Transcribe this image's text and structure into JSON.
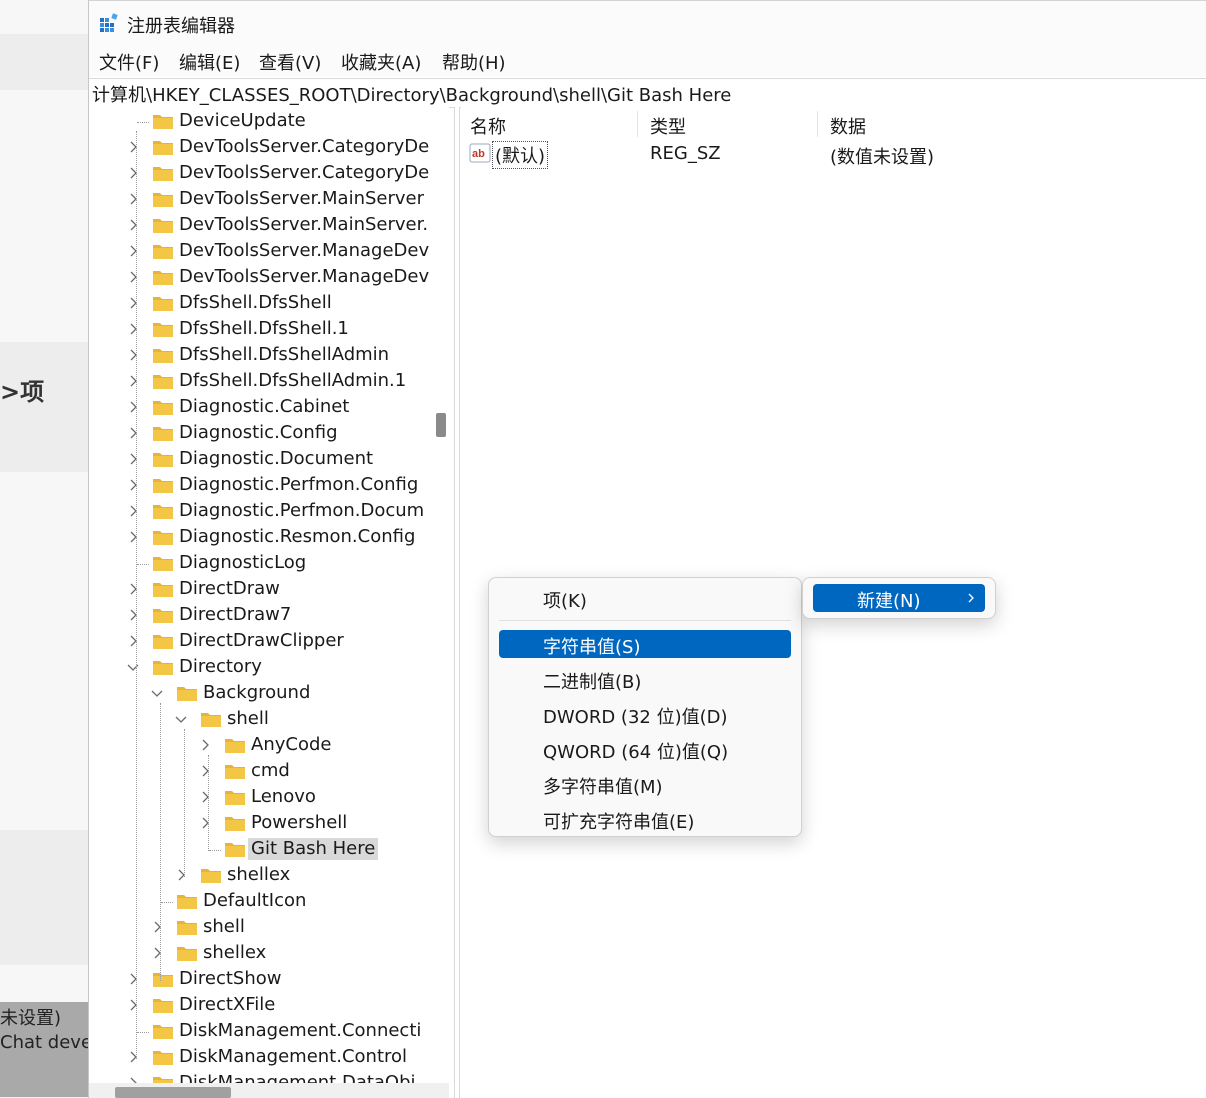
{
  "background_app": {
    "item_label": ">项",
    "lower_text_1": "未设置)",
    "lower_text_2": "Chat deve"
  },
  "window": {
    "title": "注册表编辑器",
    "icon": "registry-editor-icon"
  },
  "menu": [
    "文件(F)",
    "编辑(E)",
    "查看(V)",
    "收藏夹(A)",
    "帮助(H)"
  ],
  "address": "计算机\\HKEY_CLASSES_ROOT\\Directory\\Background\\shell\\Git Bash Here",
  "tree": [
    {
      "label": "DeviceUpdate",
      "depth": 0,
      "expander": "none"
    },
    {
      "label": "DevToolsServer.CategoryDe",
      "depth": 0,
      "expander": "collapsed"
    },
    {
      "label": "DevToolsServer.CategoryDe",
      "depth": 0,
      "expander": "collapsed"
    },
    {
      "label": "DevToolsServer.MainServer",
      "depth": 0,
      "expander": "collapsed"
    },
    {
      "label": "DevToolsServer.MainServer.",
      "depth": 0,
      "expander": "collapsed"
    },
    {
      "label": "DevToolsServer.ManageDev",
      "depth": 0,
      "expander": "collapsed"
    },
    {
      "label": "DevToolsServer.ManageDev",
      "depth": 0,
      "expander": "collapsed"
    },
    {
      "label": "DfsShell.DfsShell",
      "depth": 0,
      "expander": "collapsed"
    },
    {
      "label": "DfsShell.DfsShell.1",
      "depth": 0,
      "expander": "collapsed"
    },
    {
      "label": "DfsShell.DfsShellAdmin",
      "depth": 0,
      "expander": "collapsed"
    },
    {
      "label": "DfsShell.DfsShellAdmin.1",
      "depth": 0,
      "expander": "collapsed"
    },
    {
      "label": "Diagnostic.Cabinet",
      "depth": 0,
      "expander": "collapsed"
    },
    {
      "label": "Diagnostic.Config",
      "depth": 0,
      "expander": "collapsed"
    },
    {
      "label": "Diagnostic.Document",
      "depth": 0,
      "expander": "collapsed"
    },
    {
      "label": "Diagnostic.Perfmon.Config",
      "depth": 0,
      "expander": "collapsed"
    },
    {
      "label": "Diagnostic.Perfmon.Docum",
      "depth": 0,
      "expander": "collapsed"
    },
    {
      "label": "Diagnostic.Resmon.Config",
      "depth": 0,
      "expander": "collapsed"
    },
    {
      "label": "DiagnosticLog",
      "depth": 0,
      "expander": "none"
    },
    {
      "label": "DirectDraw",
      "depth": 0,
      "expander": "collapsed"
    },
    {
      "label": "DirectDraw7",
      "depth": 0,
      "expander": "collapsed"
    },
    {
      "label": "DirectDrawClipper",
      "depth": 0,
      "expander": "collapsed"
    },
    {
      "label": "Directory",
      "depth": 0,
      "expander": "expanded"
    },
    {
      "label": "Background",
      "depth": 1,
      "expander": "expanded"
    },
    {
      "label": "shell",
      "depth": 2,
      "expander": "expanded"
    },
    {
      "label": "AnyCode",
      "depth": 3,
      "expander": "collapsed"
    },
    {
      "label": "cmd",
      "depth": 3,
      "expander": "collapsed"
    },
    {
      "label": "Lenovo",
      "depth": 3,
      "expander": "collapsed"
    },
    {
      "label": "Powershell",
      "depth": 3,
      "expander": "collapsed"
    },
    {
      "label": "Git Bash Here",
      "depth": 3,
      "expander": "none",
      "selected": true
    },
    {
      "label": "shellex",
      "depth": 2,
      "expander": "collapsed"
    },
    {
      "label": "DefaultIcon",
      "depth": 1,
      "expander": "none"
    },
    {
      "label": "shell",
      "depth": 1,
      "expander": "collapsed"
    },
    {
      "label": "shellex",
      "depth": 1,
      "expander": "collapsed"
    },
    {
      "label": "DirectShow",
      "depth": 0,
      "expander": "collapsed"
    },
    {
      "label": "DirectXFile",
      "depth": 0,
      "expander": "collapsed"
    },
    {
      "label": "DiskManagement.Connecti",
      "depth": 0,
      "expander": "none"
    },
    {
      "label": "DiskManagement.Control",
      "depth": 0,
      "expander": "collapsed"
    },
    {
      "label": "DiskManagement.DataObj",
      "depth": 0,
      "expander": "collapsed"
    }
  ],
  "list": {
    "headers": {
      "name": "名称",
      "type": "类型",
      "data": "数据"
    },
    "rows": [
      {
        "name": "(默认)",
        "type": "REG_SZ",
        "data": "(数值未设置)",
        "icon": "string-value-icon"
      }
    ]
  },
  "context_menu": {
    "new_label": "新建(N)",
    "submenu": {
      "key_item": "项(K)",
      "items": [
        "字符串值(S)",
        "二进制值(B)",
        "DWORD (32 位)值(D)",
        "QWORD (64 位)值(Q)",
        "多字符串值(M)",
        "可扩充字符串值(E)"
      ],
      "highlighted": "字符串值(S)"
    }
  },
  "colors": {
    "accent": "#0067c0",
    "folder": "#f3c646",
    "selection": "#d9d9d9"
  }
}
